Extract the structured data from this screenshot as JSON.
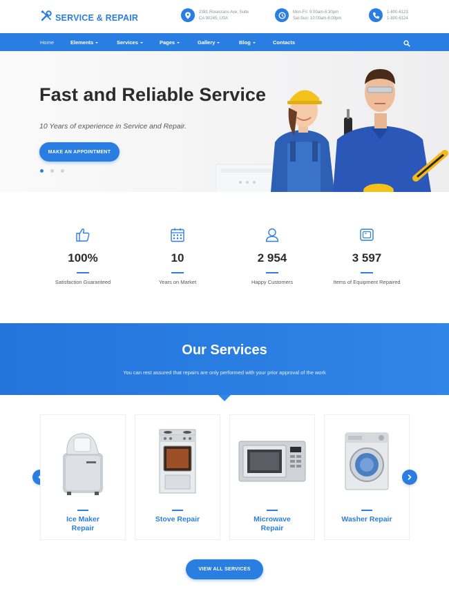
{
  "header": {
    "logo_text": "SERVICE & REPAIR",
    "address_line1": "2381 Rosecrans Ave, Suite",
    "address_line2": "CA 90245, USA",
    "hours_line1": "Mon-Fri: 9:00am-6:30pm",
    "hours_line2": "Sat-Sun: 10:00am-6:00pm",
    "phone_line1": "1-800-6123",
    "phone_line2": "1-800-6124"
  },
  "nav": {
    "items": [
      {
        "label": "Home"
      },
      {
        "label": "Elements"
      },
      {
        "label": "Services"
      },
      {
        "label": "Pages"
      },
      {
        "label": "Gallery"
      },
      {
        "label": "Blog"
      },
      {
        "label": "Contacts"
      }
    ]
  },
  "hero": {
    "title": "Fast and Reliable Service",
    "subtitle": "10 Years of experience in Service and Repair.",
    "cta_label": "MAKE AN APPOINTMENT",
    "active_slide": 1,
    "slide_count": 3
  },
  "stats": [
    {
      "value": "100%",
      "label": "Satisfaction Guaranteed",
      "icon": "thumbs-up-icon"
    },
    {
      "value": "10",
      "label": "Years on Market",
      "icon": "calendar-icon"
    },
    {
      "value": "2 954",
      "label": "Happy Customers",
      "icon": "user-icon"
    },
    {
      "value": "3 597",
      "label": "Items of Equipment Repaired",
      "icon": "monitor-icon"
    }
  ],
  "services": {
    "title": "Our Services",
    "subtitle": "You can rest assured that repairs are only performed with your prior approval of the work",
    "cards": [
      {
        "line1": "Ice Maker",
        "line2": "Repair",
        "icon": "ice-maker-icon"
      },
      {
        "line1": "Stove Repair",
        "line2": "",
        "icon": "stove-icon"
      },
      {
        "line1": "Microwave",
        "line2": "Repair",
        "icon": "microwave-icon"
      },
      {
        "line1": "Washer Repair",
        "line2": "",
        "icon": "washer-icon"
      }
    ],
    "view_all_label": "VIEW ALL SERVICES"
  },
  "colors": {
    "accent": "#2a7de1",
    "text_dark": "#2b2b2b",
    "text_muted": "#8a8f99"
  }
}
